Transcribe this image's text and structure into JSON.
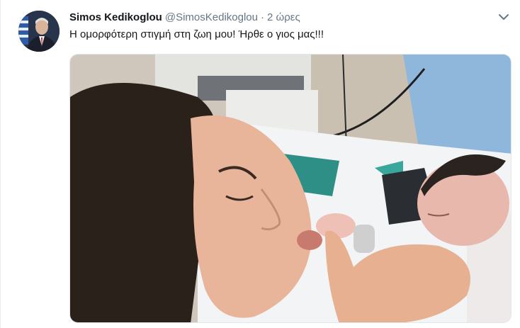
{
  "tweet": {
    "author_name": "Simos Kedikoglou",
    "handle": "@SimosKedikoglou",
    "separator": "·",
    "time": "2 ώρες",
    "text": "Η ομορφότερη στιγμή στη ζωη μου! Ήρθε ο γιος μας!!!",
    "menu_icon": "chevron-down-icon",
    "avatar_icon": "profile-avatar",
    "photo": "photo of a woman kissing a newborn baby's hand"
  },
  "colors": {
    "name": "#14171a",
    "meta": "#657786",
    "border": "#e1e8ed"
  }
}
